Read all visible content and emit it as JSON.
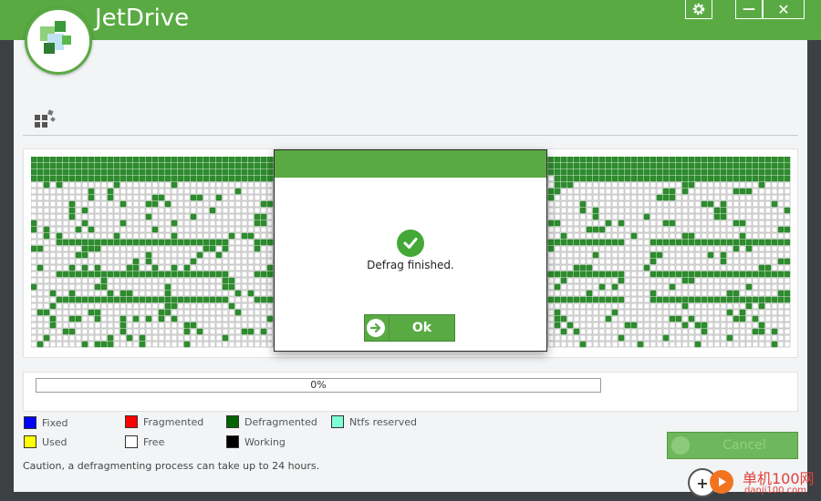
{
  "app": {
    "title": "JetDrive"
  },
  "window_controls": {
    "minimize": "—",
    "close": "✕"
  },
  "disk_map": {
    "colors": {
      "defragmented": "#2e8b2e",
      "free": "#ffffff",
      "free_border": "#a8a8a8"
    }
  },
  "progress": {
    "value": 0,
    "label": "0%"
  },
  "legend": [
    {
      "label": "Fixed",
      "color": "#0000ff"
    },
    {
      "label": "Fragmented",
      "color": "#ff0000"
    },
    {
      "label": "Defragmented",
      "color": "#006400"
    },
    {
      "label": "Ntfs reserved",
      "color": "#7fffd4"
    },
    {
      "label": "Used",
      "color": "#ffff00"
    },
    {
      "label": "Free",
      "color": "#ffffff"
    },
    {
      "label": "Working",
      "color": "#000000"
    }
  ],
  "caution": "Caution, a defragmenting process can take up to 24 hours.",
  "cancel_button": {
    "label": "Cancel"
  },
  "dialog": {
    "message": "Defrag finished.",
    "ok_label": "Ok"
  },
  "watermark": {
    "title": "单机100网",
    "subtitle": "danji100.com"
  },
  "colors": {
    "accent": "#5aaa44",
    "dialog_check": "#43a836"
  }
}
